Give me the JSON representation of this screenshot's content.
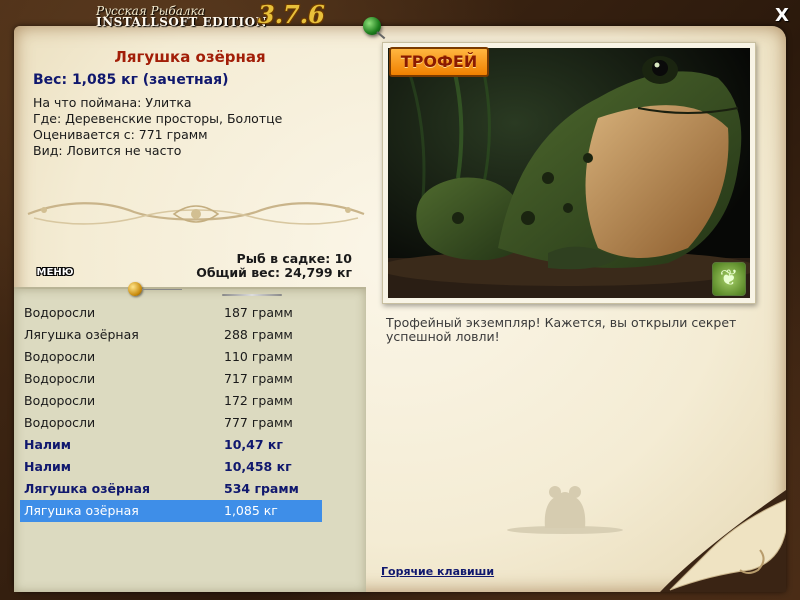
{
  "window": {
    "title_top": "Русская Рыбалка",
    "title_main": "INSTALLSOFT EDITION",
    "version": "3.7.6",
    "close_label": "X"
  },
  "fish": {
    "name": "Лягушка озёрная",
    "weight": "Вес: 1,085 кг (зачетная)",
    "bait": "На что поймана: Улитка",
    "place": "Где: Деревенские просторы, Болотце",
    "valued": "Оценивается с: 771 грамм",
    "kind": "Вид: Ловится не часто"
  },
  "menu_label": "МЕНЮ",
  "stats": {
    "count": "Рыб в садке: 10",
    "total": "Общий вес: 24,799 кг"
  },
  "catch_list": [
    {
      "name": "Водоросли",
      "weight": "187 грамм",
      "trophy": false
    },
    {
      "name": "Лягушка озёрная",
      "weight": "288 грамм",
      "trophy": false
    },
    {
      "name": "Водоросли",
      "weight": "110 грамм",
      "trophy": false
    },
    {
      "name": "Водоросли",
      "weight": "717 грамм",
      "trophy": false
    },
    {
      "name": "Водоросли",
      "weight": "172 грамм",
      "trophy": false
    },
    {
      "name": "Водоросли",
      "weight": "777 грамм",
      "trophy": false
    },
    {
      "name": "Налим",
      "weight": "10,47 кг",
      "trophy": true
    },
    {
      "name": "Налим",
      "weight": "10,458 кг",
      "trophy": true
    },
    {
      "name": "Лягушка озёрная",
      "weight": "534 грамм",
      "trophy": true
    },
    {
      "name": "Лягушка озёрная",
      "weight": "1,085 кг",
      "trophy": true,
      "selected": true
    }
  ],
  "photo": {
    "badge": "ТРОФЕЙ",
    "icon": "butterfly-icon"
  },
  "description": "Трофейный экземпляр! Кажется, вы открыли секрет успешной ловли!",
  "hotkeys_label": "Горячие клавиши",
  "colors": {
    "fish_name": "#a21e08",
    "trophy_text": "#10186e",
    "selected_row": "#3e8ee8",
    "badge": "#f08000"
  }
}
